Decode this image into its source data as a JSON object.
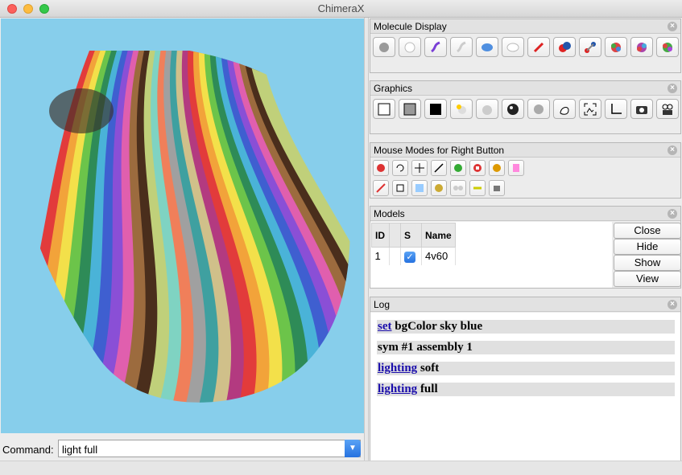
{
  "window": {
    "title": "ChimeraX"
  },
  "command": {
    "label": "Command:",
    "value": "light full"
  },
  "panels": {
    "molecule_display": {
      "title": "Molecule Display",
      "icons": [
        "atoms-ball-icon",
        "atoms-hide-icon",
        "cartoon-show-icon",
        "cartoon-hide-icon",
        "surface-show-icon",
        "surface-hide-icon",
        "stick-style-icon",
        "sphere-style-icon",
        "ball-style-icon",
        "color-chain-icon",
        "color-element-icon",
        "color-hetero-icon"
      ]
    },
    "graphics": {
      "title": "Graphics",
      "icons": [
        "bg-white-icon",
        "bg-gray-icon",
        "bg-black-icon",
        "lighting-default-icon",
        "lighting-simple-icon",
        "lighting-full-icon",
        "lighting-soft-icon",
        "silhouette-icon",
        "view-all-icon",
        "orient-icon",
        "snapshot-icon",
        "movie-record-icon"
      ]
    },
    "mouse_modes": {
      "title": "Mouse Modes for Right Button",
      "row1": [
        "select-mode-icon",
        "rotate-mode-icon",
        "translate-mode-icon",
        "zoom-mode-icon",
        "translate-atoms-icon",
        "label-mode-icon",
        "pick-mode-icon",
        "clip-mode-icon"
      ],
      "row2": [
        "contour-mode-icon",
        "move-planes-icon",
        "crop-mode-icon",
        "place-marker-icon",
        "distance-mode-icon",
        "bond-rotation-icon",
        "swap-aa-icon"
      ]
    },
    "models": {
      "title": "Models",
      "headers": {
        "id": "ID",
        "s": "S",
        "name": "Name"
      },
      "rows": [
        {
          "id": "1",
          "name": "4v60",
          "shown": true
        }
      ],
      "buttons": {
        "close": "Close",
        "hide": "Hide",
        "show": "Show",
        "view": "View"
      }
    },
    "log": {
      "title": "Log",
      "lines": [
        {
          "link": "set",
          "rest": " bgColor sky blue"
        },
        {
          "link": "",
          "rest": "sym #1 assembly 1"
        },
        {
          "link": "lighting",
          "rest": " soft"
        },
        {
          "link": "lighting",
          "rest": " full"
        }
      ]
    }
  },
  "colors": {
    "viewport_bg": "#87ceeb",
    "accent_blue": "#2672e0"
  }
}
